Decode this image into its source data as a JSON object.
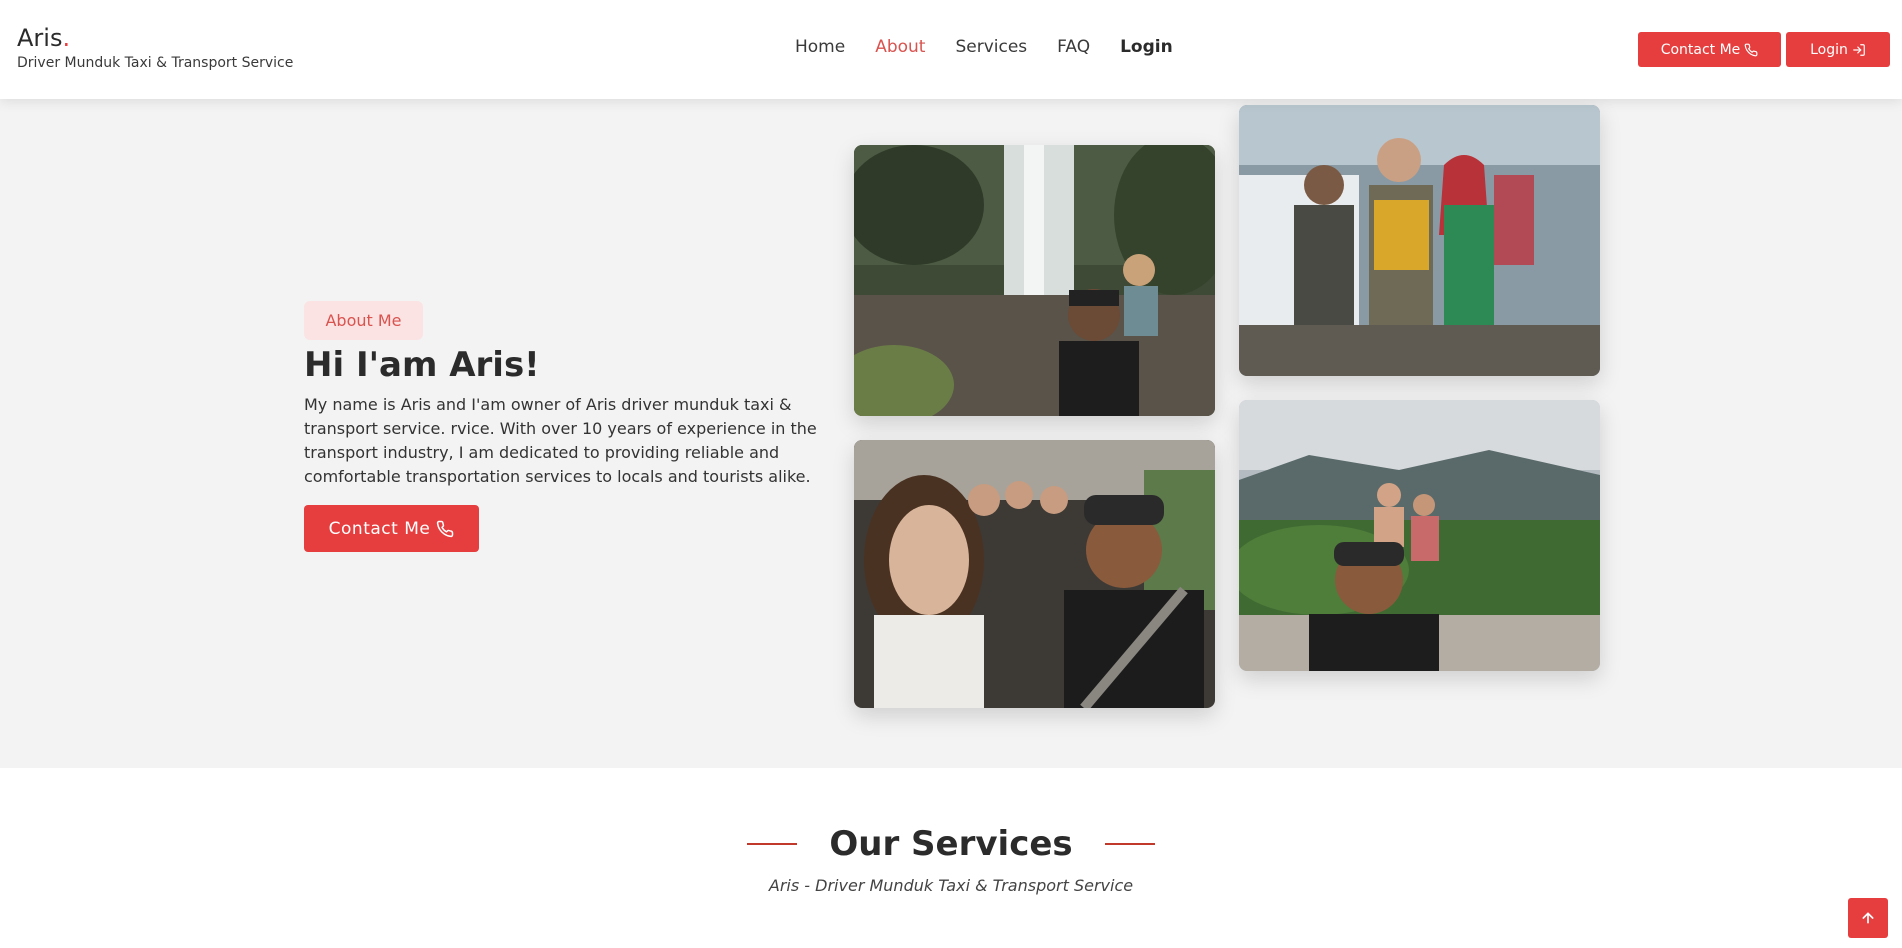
{
  "brand": {
    "name": "Aris",
    "dot": ".",
    "tagline": "Driver Munduk Taxi & Transport Service"
  },
  "nav": {
    "home": "Home",
    "about": "About",
    "services": "Services",
    "faq": "FAQ",
    "login": "Login"
  },
  "header_buttons": {
    "contact": "Contact Me",
    "login": "Login"
  },
  "about": {
    "badge": "About Me",
    "title": "Hi I'am Aris!",
    "text": "My name is Aris and I'am owner of Aris driver munduk taxi & transport service. rvice. With over 10 years of experience in the transport industry, I am dedicated to providing reliable and comfortable transportation services to locals and tourists alike.",
    "button": "Contact Me"
  },
  "services": {
    "title": "Our Services",
    "subtitle": "Aris - Driver Munduk Taxi & Transport Service"
  },
  "colors": {
    "accent": "#e63e3e",
    "badge_bg": "#fbe3e3",
    "hero_bg": "#f3f3f3"
  },
  "icons": [
    "phone-icon",
    "login-icon",
    "arrow-up-icon"
  ]
}
